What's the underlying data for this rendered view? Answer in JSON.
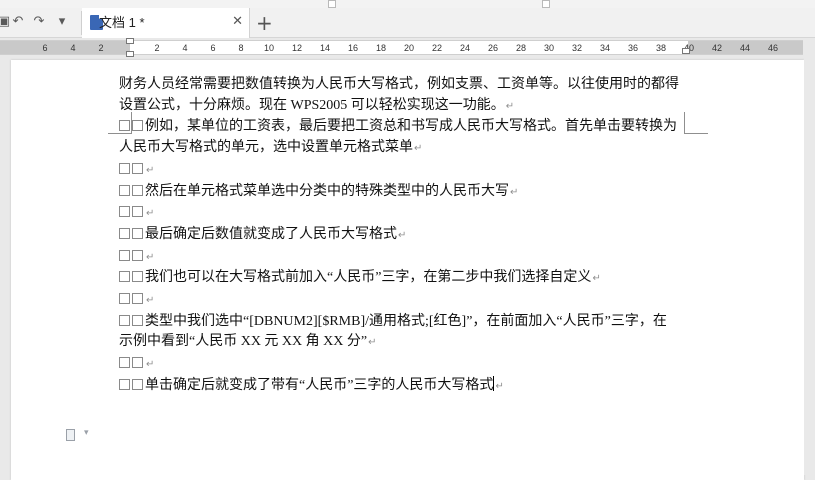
{
  "quick_access": {
    "undo_icon": "↶",
    "redo_icon": "↷",
    "more_icon": "▾"
  },
  "tab": {
    "title": "文档 1 *",
    "close_icon": "✕",
    "new_tab_icon": "+"
  },
  "ruler": {
    "labels": [
      "6",
      "4",
      "2",
      "2",
      "4",
      "6",
      "8",
      "10",
      "12",
      "14",
      "16",
      "18",
      "20",
      "22",
      "24",
      "26",
      "28",
      "30",
      "32",
      "34",
      "36",
      "38",
      "40",
      "42",
      "44",
      "46"
    ]
  },
  "paragraph_mark": "↵",
  "document": {
    "paragraphs": [
      {
        "indent": false,
        "text": "财务人员经常需要把数值转换为人民币大写格式，例如支票、工资单等。以往使用时的都得设置公式，十分麻烦。现在 WPS2005 可以轻松实现这一功能。"
      },
      {
        "indent": true,
        "text": "例如，某单位的工资表，最后要把工资总和书写成人民币大写格式。首先单击要转换为人民币大写格式的单元，选中设置单元格式菜单"
      },
      {
        "indent": true,
        "text": ""
      },
      {
        "indent": true,
        "text": "然后在单元格式菜单选中分类中的特殊类型中的人民币大写"
      },
      {
        "indent": true,
        "text": ""
      },
      {
        "indent": true,
        "text": "最后确定后数值就变成了人民币大写格式"
      },
      {
        "indent": true,
        "text": ""
      },
      {
        "indent": true,
        "text": "我们也可以在大写格式前加入“人民币”三字，在第二步中我们选择自定义"
      },
      {
        "indent": true,
        "text": ""
      },
      {
        "indent": true,
        "text": "类型中我们选中“[DBNUM2][$RMB]/通用格式;[红色]”，在前面加入“人民币”三字，在示例中看到“人民币 XX 元 XX 角 XX 分”"
      },
      {
        "indent": true,
        "text": ""
      },
      {
        "indent": true,
        "text": "单击确定后就变成了带有“人民币”三字的人民币大写格式"
      }
    ]
  }
}
